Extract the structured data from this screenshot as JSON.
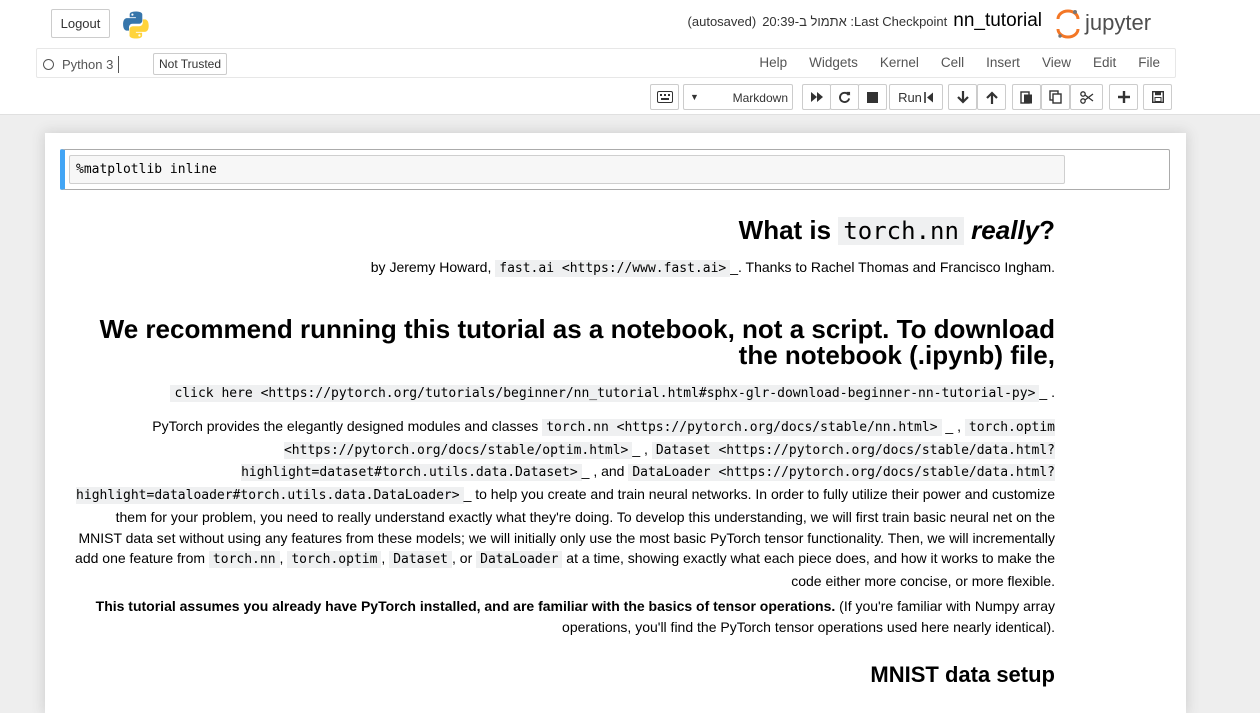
{
  "header": {
    "logout_label": "Logout",
    "notebook_name": "nn_tutorial",
    "checkpoint": "Last Checkpoint: אתמול ב-20:39",
    "autosave_status": "(autosaved)",
    "brand": "jupyter"
  },
  "menubar": {
    "kernel_name": "Python 3",
    "trust_status": "Not Trusted",
    "items": [
      "File",
      "Edit",
      "View",
      "Insert",
      "Cell",
      "Kernel",
      "Widgets",
      "Help"
    ]
  },
  "toolbar": {
    "run_label": "Run",
    "cell_type": "Markdown",
    "buttons": [
      "save-icon",
      "add-icon",
      "cut-icon",
      "copy-icon",
      "paste-icon",
      "move-up-icon",
      "move-down-icon",
      "run-icon",
      "stop-icon",
      "restart-icon",
      "fast-forward-icon",
      "keyboard-icon"
    ]
  },
  "cells": {
    "code": "%matplotlib inline",
    "h1": {
      "before": "What is ",
      "code": "torch.nn",
      "em": "really",
      "after": "?"
    },
    "byline": {
      "text1": "by Jeremy Howard, ",
      "code": "fast.ai <https://www.fast.ai>",
      "text2": "_. Thanks to Rachel Thomas and Francisco Ingham."
    },
    "h2": "We recommend running this tutorial as a notebook, not a script. To download the notebook (.ipynb) file,",
    "click_here": {
      "code": "click here <https://pytorch.org/tutorials/beginner/nn_tutorial.html#sphx-glr-download-beginner-nn-tutorial-py>",
      "tail": "_ ."
    },
    "para1": {
      "t1": "PyTorch provides the elegantly designed modules and classes ",
      "c1": "torch.nn <https://pytorch.org/docs/stable/nn.html>",
      "t2": " _ , ",
      "c2": "torch.optim <https://pytorch.org/docs/stable/optim.html>",
      "t3": "_ , ",
      "c3": "Dataset <https://pytorch.org/docs/stable/data.html?highlight=dataset#torch.utils.data.Dataset>",
      "t4": "_ , and ",
      "c4": "DataLoader <https://pytorch.org/docs/stable/data.html?highlight=dataloader#torch.utils.data.DataLoader>",
      "t5": "_ to help you create and train neural networks. In order to fully utilize their power and customize them for your problem, you need to really understand exactly what they're doing. To develop this understanding, we will first train basic neural net on the MNIST data set without using any features from these models; we will initially only use the most basic PyTorch tensor functionality. Then, we will incrementally add one feature from ",
      "c5": "torch.nn",
      "t6": ", ",
      "c6": "torch.optim",
      "t7": ", ",
      "c7": "Dataset",
      "t8": ", or ",
      "c8": "DataLoader",
      "t9": " at a time, showing exactly what each piece does, and how it works to make the code either more concise, or more flexible."
    },
    "para2": {
      "bold": "This tutorial assumes you already have PyTorch installed, and are familiar with the basics of tensor operations.",
      "rest": " (If you're familiar with Numpy array operations, you'll find the PyTorch tensor operations used here nearly identical)."
    },
    "h3": "MNIST data setup"
  }
}
